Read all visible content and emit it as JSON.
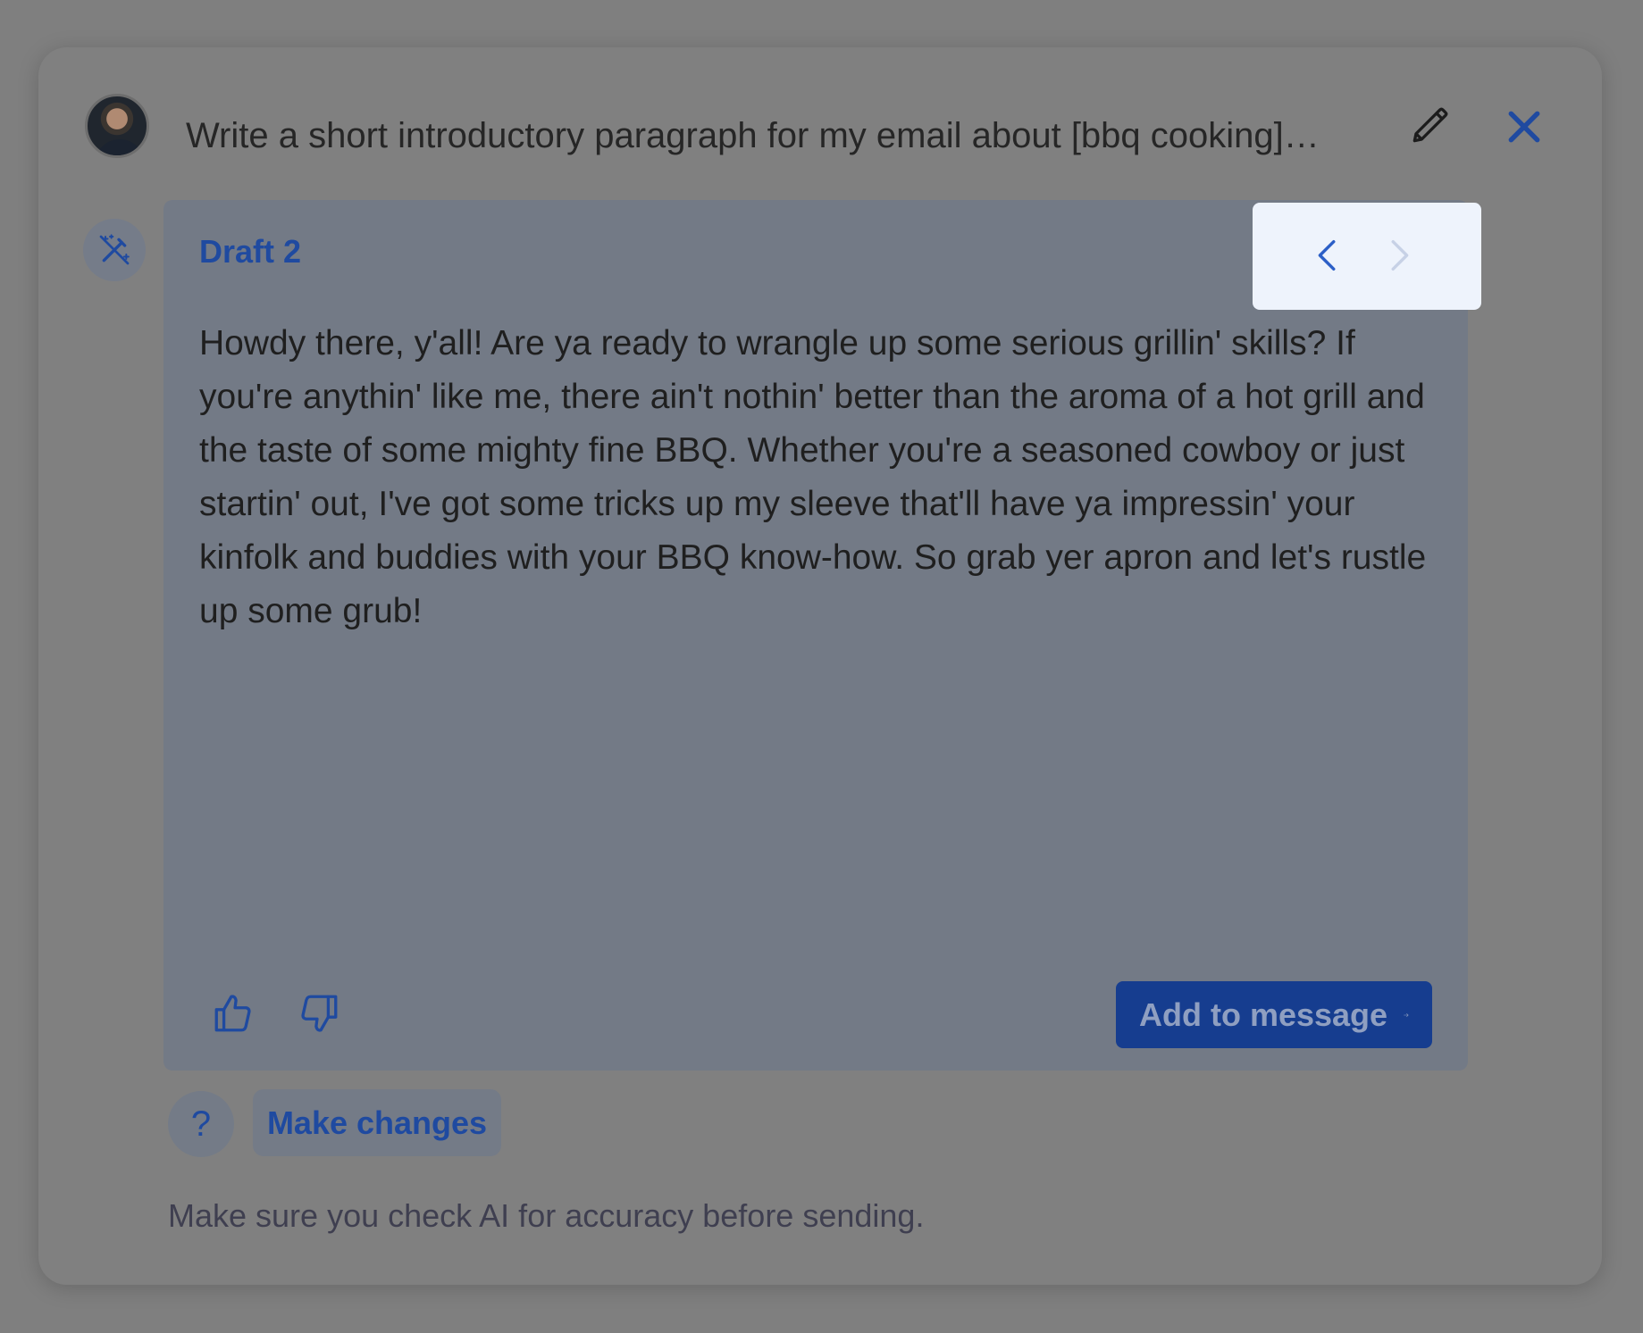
{
  "header": {
    "prompt": "Write a short introductory paragraph for my email about [bbq cooking]…",
    "edit_icon": "pencil-icon",
    "close_icon": "close-icon",
    "avatar": "user-avatar"
  },
  "draft": {
    "label": "Draft 2",
    "body": "Howdy there, y'all! Are ya ready to wrangle up some serious grillin' skills? If you're anythin' like me, there ain't nothin' better than the aroma of a hot grill and the taste of some mighty fine BBQ. Whether you're a seasoned cowboy or just startin' out, I've got some tricks up my sleeve that'll have ya impressin' your kinfolk and buddies with your BBQ know-how. So grab yer apron and let's rustle up some grub!",
    "ai_icon": "magic-wand-icon",
    "nav": {
      "prev_icon": "chevron-left-icon",
      "next_icon": "chevron-right-icon"
    }
  },
  "feedback": {
    "thumbs_up_icon": "thumbs-up-icon",
    "thumbs_down_icon": "thumbs-down-icon"
  },
  "actions": {
    "add_to_message": "Add to message",
    "help": "?",
    "make_changes": "Make changes"
  },
  "footer": {
    "disclaimer": "Make sure you check AI for accuracy before sending."
  },
  "colors": {
    "accent": "#1f4aa0",
    "primary_button": "#163d8f",
    "overlay": "#7f7f7f"
  }
}
